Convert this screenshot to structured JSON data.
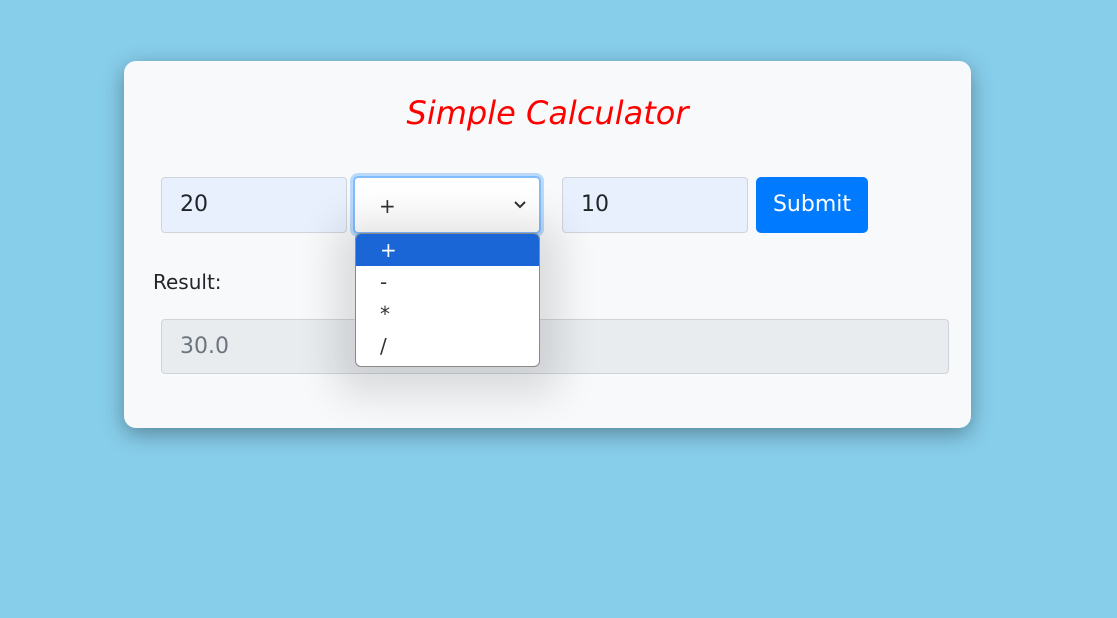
{
  "app": {
    "title": "Simple Calculator"
  },
  "form": {
    "first_number": "20",
    "operator_selected": "+",
    "second_number": "10",
    "submit_label": "Submit"
  },
  "operator_options": [
    "+",
    "-",
    "*",
    "/"
  ],
  "result": {
    "label": "Result:",
    "value": "30.0"
  },
  "colors": {
    "background": "#87ceeb",
    "title": "#ff0000",
    "button": "#007bff",
    "selected_option": "#1a66d6"
  }
}
